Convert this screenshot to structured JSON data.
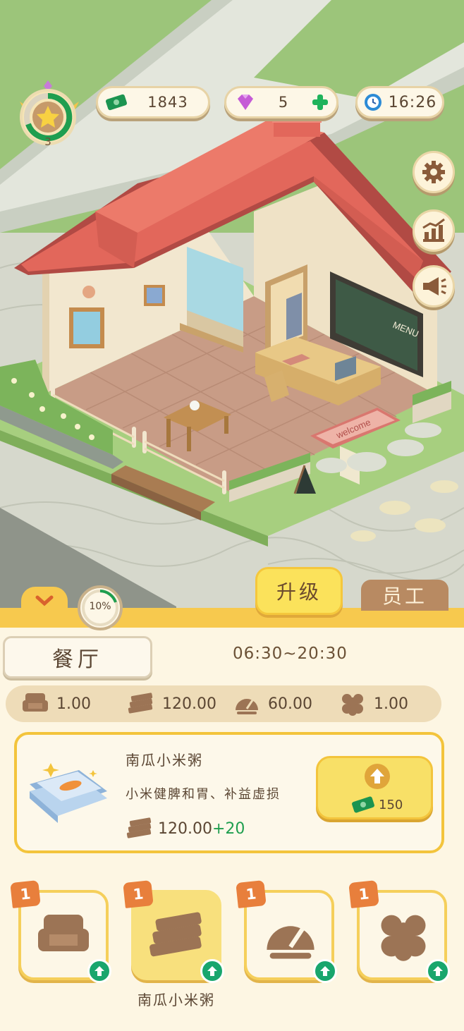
{
  "hud": {
    "level": "3",
    "cash": "1843",
    "gems": "5",
    "time": "16:26"
  },
  "scene": {
    "doormat_text": "welcome",
    "menu_board_text": "MENU"
  },
  "panel": {
    "collapse_progress": "10%",
    "tab_upgrade": "升级",
    "tab_staff": "员工",
    "room_name": "餐厅",
    "hours": "06:30~20:30",
    "stats": {
      "seats": "1.00",
      "income": "120.00",
      "speed": "60.00",
      "customers": "1.00"
    },
    "item": {
      "name": "南瓜小米粥",
      "description": "小米健脾和胃、补益虚损",
      "income": "120.00",
      "income_bonus": "+20",
      "upgrade_cost": "150"
    },
    "upgrade_cards": [
      {
        "level": "1",
        "icon": "sofa-icon"
      },
      {
        "level": "1",
        "icon": "money-stack-icon"
      },
      {
        "level": "1",
        "icon": "speedometer-icon"
      },
      {
        "level": "1",
        "icon": "customer-icon"
      }
    ],
    "selected_card_label": "南瓜小米粥"
  },
  "colors": {
    "accent_yellow": "#f7c94e",
    "brand_brown": "#8a6a4b",
    "green_plus": "#19a66d",
    "roof_red": "#e2675b"
  }
}
